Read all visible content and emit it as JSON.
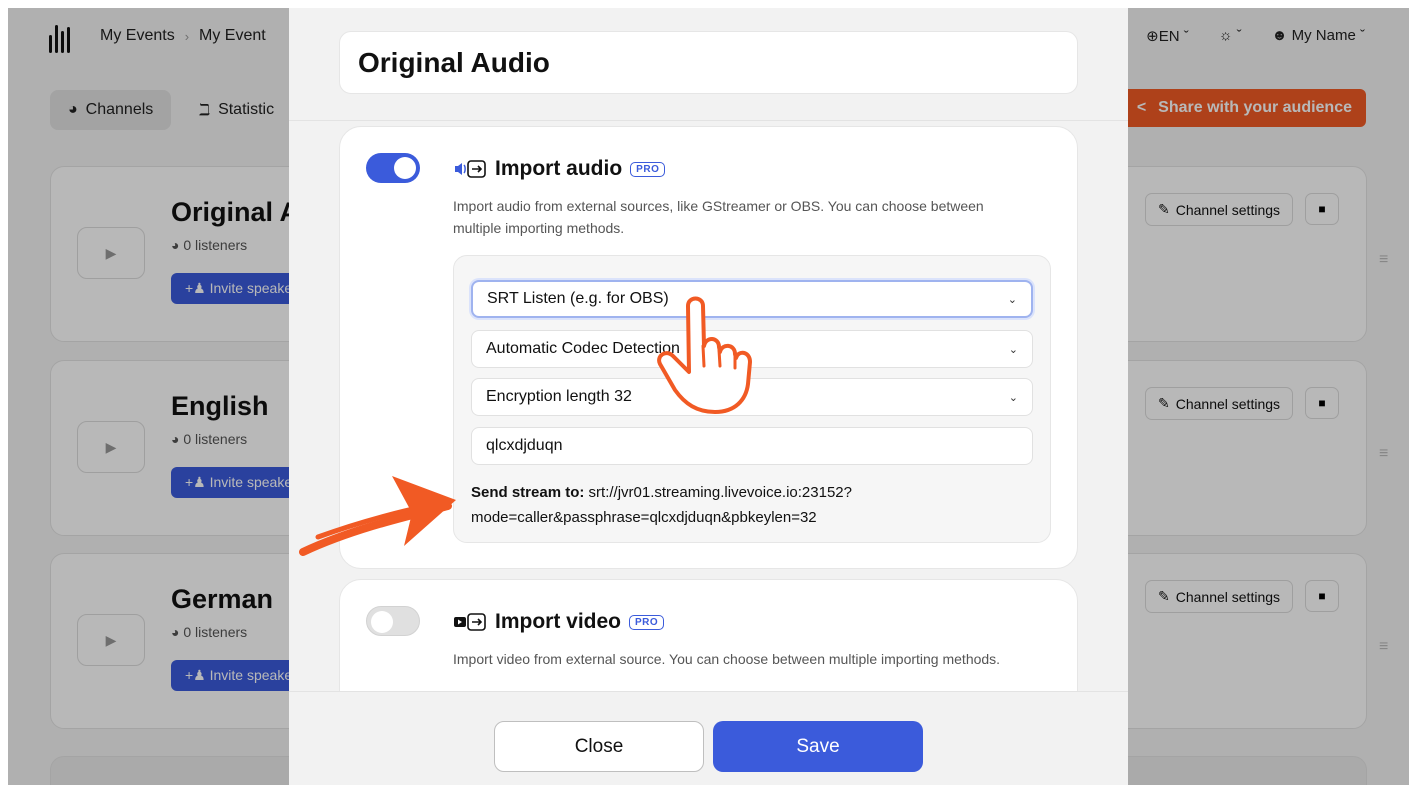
{
  "header": {
    "breadcrumbs": [
      "My Events",
      "My Event"
    ],
    "language": "EN",
    "user": "My Name"
  },
  "tabs": [
    {
      "label": "Channels",
      "icon": "headphones-icon"
    },
    {
      "label": "Statistic",
      "icon": "bar-chart-icon"
    }
  ],
  "share_label": "Share with your audience",
  "channels": [
    {
      "name": "Original A",
      "listeners": "0 listeners",
      "invite": "Invite speake",
      "settings": "Channel settings"
    },
    {
      "name": "English",
      "listeners": "0 listeners",
      "invite": "Invite speake",
      "settings": "Channel settings"
    },
    {
      "name": "German",
      "listeners": "0 listeners",
      "invite": "Invite speake",
      "settings": "Channel settings"
    }
  ],
  "modal": {
    "title": "Original Audio",
    "import_audio": {
      "enabled": true,
      "title": "Import audio",
      "badge": "PRO",
      "description": "Import audio from external sources, like GStreamer or OBS. You can choose between multiple importing methods.",
      "method": "SRT Listen (e.g. for OBS)",
      "codec": "Automatic Codec Detection",
      "encryption": "Encryption length 32",
      "passphrase": "qlcxdjduqn",
      "send_label": "Send stream to:",
      "send_url_1": "srt://jvr01.streaming.livevoice.io:23152?",
      "send_url_2": "mode=caller&passphrase=qlcxdjduqn&pbkeylen=32"
    },
    "import_video": {
      "enabled": false,
      "title": "Import video",
      "badge": "PRO",
      "description": "Import video from external source. You can choose between multiple importing methods."
    },
    "close_label": "Close",
    "save_label": "Save"
  },
  "colors": {
    "primary": "#3b5bdb",
    "accent": "#f15a24"
  }
}
